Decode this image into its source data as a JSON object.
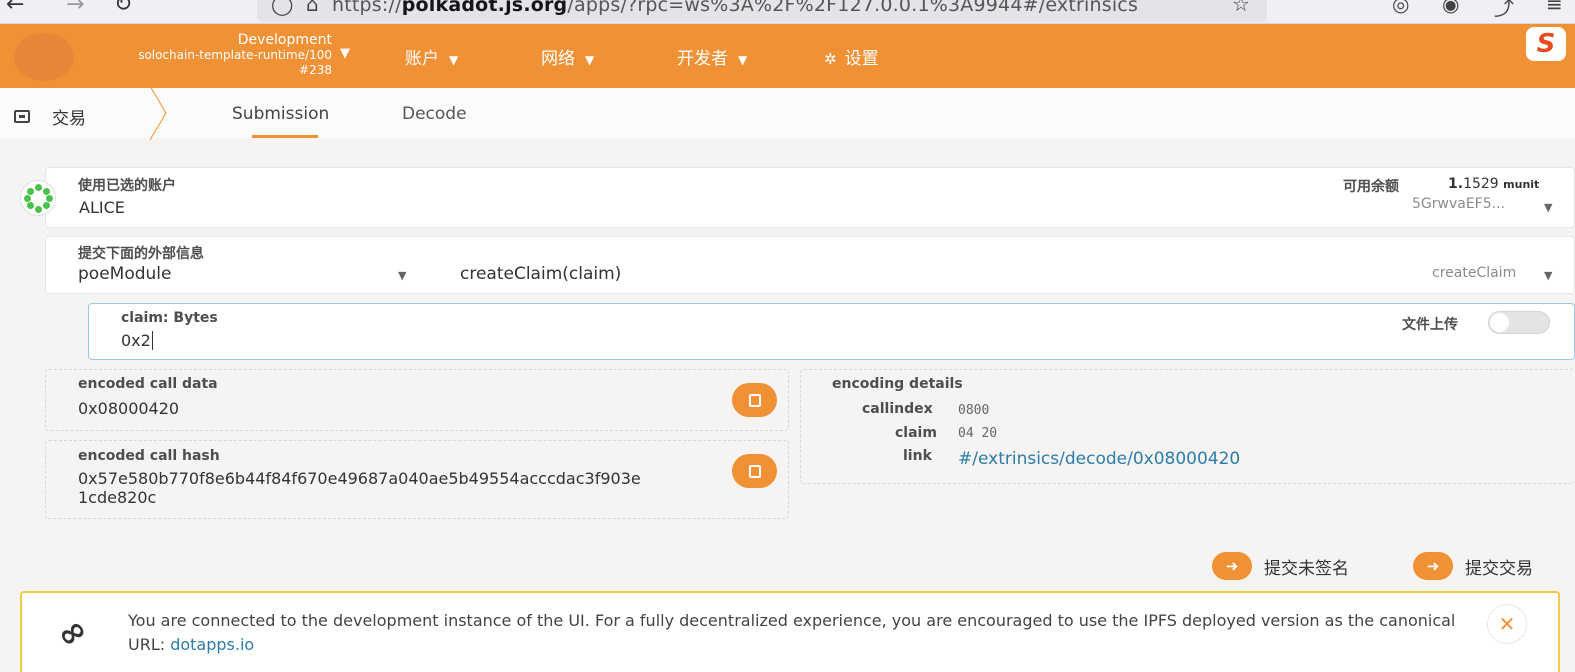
{
  "browser": {
    "back_icon": "arrow-left-icon",
    "url_prefix": "https://",
    "url_domain": "polkadot.js.org",
    "url_rest": "/apps/?rpc=ws%3A%2F%2F127.0.0.1%3A9944#/extrinsics"
  },
  "header": {
    "chain_name": "Development",
    "runtime": "solochain-template-runtime/100",
    "block": "#238",
    "menu": [
      "账户",
      "网络",
      "开发者",
      "设置"
    ],
    "accent": "#f19135"
  },
  "tabs": {
    "title": "交易",
    "items": [
      "Submission",
      "Decode"
    ],
    "active": "Submission"
  },
  "account": {
    "label": "使用已选的账户",
    "name": "ALICE",
    "balance_label": "可用余额",
    "balance_int": "1.",
    "balance_dec": "1529",
    "balance_unit": "munit",
    "address": "5GrwvaEF5..."
  },
  "extrinsic": {
    "label": "提交下面的外部信息",
    "module": "poeModule",
    "call": "createClaim(claim)",
    "call_short": "createClaim"
  },
  "param": {
    "label": "claim: Bytes",
    "value": "0x2",
    "file_upload_label": "文件上传",
    "file_upload_on": false
  },
  "encoded": {
    "call_data_label": "encoded call data",
    "call_data": "0x08000420",
    "call_hash_label": "encoded call hash",
    "call_hash_line1": "0x57e580b770f8e6b44f84f670e49687a040ae5b49554acccdac3f903e",
    "call_hash_line2": "1cde820c"
  },
  "details": {
    "label": "encoding details",
    "callindex_label": "callindex",
    "callindex": "0800",
    "claim_label": "claim",
    "claim": "04 20",
    "link_label": "link",
    "link": "#/extrinsics/decode/0x08000420"
  },
  "actions": {
    "unsigned": "提交未签名",
    "submit": "提交交易"
  },
  "notice": {
    "text": "You are connected to the development instance of the UI. For a fully decentralized experience, you are encouraged to use the IPFS deployed version as the canonical URL: ",
    "link": "dotapps.io"
  }
}
